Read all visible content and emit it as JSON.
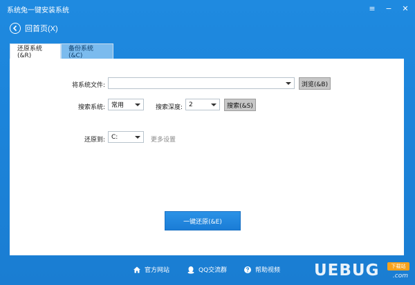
{
  "app": {
    "title": "系统兔一键安装系统"
  },
  "window_controls": {
    "menu": "≡",
    "minimize": "−",
    "close": "✕"
  },
  "nav": {
    "back_label": "回首页(X)"
  },
  "tabs": [
    {
      "label": "还原系统(&R)",
      "active": true
    },
    {
      "label": "备份系统(&C)",
      "active": false
    }
  ],
  "restore": {
    "file_label": "将系统文件:",
    "file_value": "",
    "browse_button": "浏览(&B)",
    "search_system_label": "搜索系统:",
    "search_system_value": "常用",
    "search_depth_label": "搜索深度:",
    "search_depth_value": "2",
    "search_button": "搜索(&S)",
    "restore_to_label": "还原到:",
    "restore_to_value": "C:",
    "more_settings": "更多设置",
    "one_key_restore_button": "一键还原(&E)"
  },
  "footer": {
    "items": [
      {
        "label": "官方网站",
        "icon": "home-icon"
      },
      {
        "label": "QQ交流群",
        "icon": "qq-icon"
      },
      {
        "label": "帮助视频",
        "icon": "help-icon"
      }
    ],
    "watermark": {
      "text": "UEBUG",
      "tag": "下载站",
      "suffix": ".com"
    }
  },
  "colors": {
    "window_blue": "#1c84da",
    "tab_inactive": "#7bbbee",
    "primary_button": "#1f86dd",
    "watermark_tag": "#f7a21b"
  }
}
